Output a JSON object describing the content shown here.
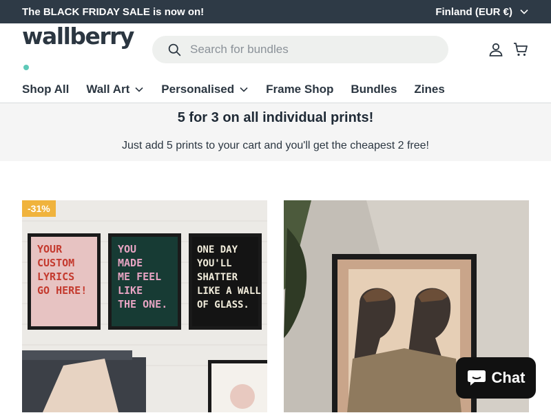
{
  "announcement": {
    "text": "The BLACK FRIDAY SALE is now on!",
    "region": "Finland (EUR €)"
  },
  "header": {
    "logo": "wallberry",
    "search_placeholder": "Search for bundles",
    "icons": [
      "search-icon",
      "account-icon",
      "cart-icon"
    ]
  },
  "nav": {
    "items": [
      {
        "label": "Shop All",
        "dropdown": false
      },
      {
        "label": "Wall Art",
        "dropdown": true
      },
      {
        "label": "Personalised",
        "dropdown": true
      },
      {
        "label": "Frame Shop",
        "dropdown": false
      },
      {
        "label": "Bundles",
        "dropdown": false
      },
      {
        "label": "Zines",
        "dropdown": false
      }
    ]
  },
  "promo": {
    "title": "5 for 3 on all individual prints!",
    "subtitle": "Just add 5 prints to your cart and you'll get the cheapest 2 free!"
  },
  "products": [
    {
      "badge": "-31%",
      "posters": [
        {
          "text": "YOUR CUSTOM LYRICS GO HERE!"
        },
        {
          "text": "YOU MADE ME FEEL LIKE THE ONE."
        },
        {
          "text": "ONE DAY YOU'LL SHATTER LIKE A WALL OF GLASS."
        }
      ]
    },
    {
      "badge": ""
    }
  ],
  "chat": {
    "label": "Chat"
  },
  "colors": {
    "announcement_bg": "#2e3a46",
    "badge": "#f0b33d",
    "logo_dot": "#5ec9b8",
    "search_bg": "#eef0ee"
  }
}
